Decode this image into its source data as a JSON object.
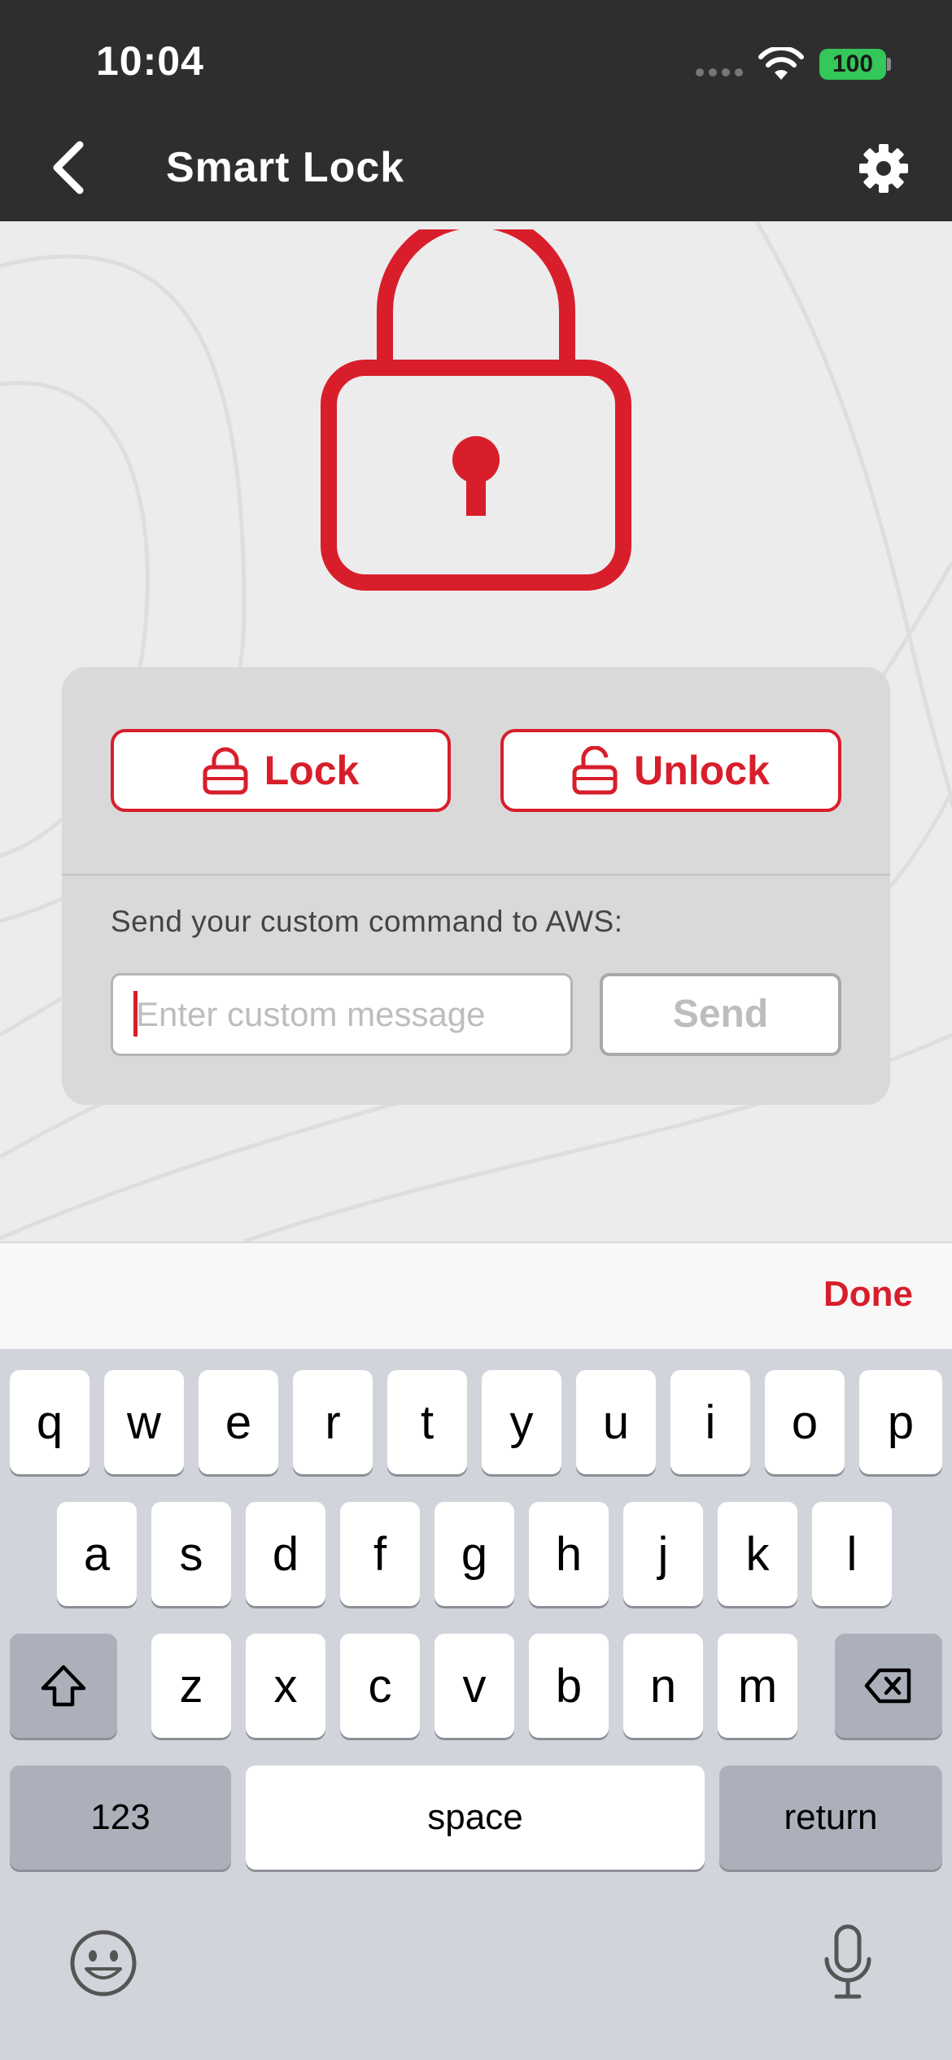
{
  "status_bar": {
    "time": "10:04",
    "battery": "100"
  },
  "nav": {
    "title": "Smart Lock"
  },
  "controls": {
    "lock_label": "Lock",
    "unlock_label": "Unlock",
    "aws_prompt": "Send your custom command to AWS:",
    "message_placeholder": "Enter custom message",
    "send_label": "Send"
  },
  "accessory": {
    "done_label": "Done"
  },
  "keyboard": {
    "row1": [
      "q",
      "w",
      "e",
      "r",
      "t",
      "y",
      "u",
      "i",
      "o",
      "p"
    ],
    "row2": [
      "a",
      "s",
      "d",
      "f",
      "g",
      "h",
      "j",
      "k",
      "l"
    ],
    "row3": [
      "z",
      "x",
      "c",
      "v",
      "b",
      "n",
      "m"
    ],
    "numbers_label": "123",
    "space_label": "space",
    "return_label": "return"
  },
  "colors": {
    "accent": "#d81e2b",
    "topbar": "#2e2e2e",
    "battery": "#34c759"
  }
}
